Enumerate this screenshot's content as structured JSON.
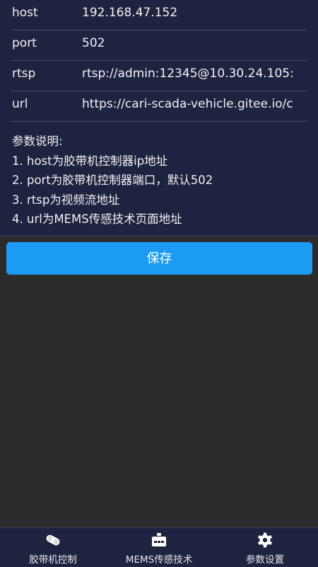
{
  "settings": {
    "fields": [
      {
        "label": "host",
        "value": "192.168.47.152"
      },
      {
        "label": "port",
        "value": "502"
      },
      {
        "label": "rtsp",
        "value": "rtsp://admin:12345@10.30.24.105:"
      },
      {
        "label": "url",
        "value": "https://cari-scada-vehicle.gitee.io/c"
      }
    ],
    "notes": [
      "参数说明:",
      "1. host为胶带机控制器ip地址",
      "2. port为胶带机控制器端口，默认502",
      "3. rtsp为视频流地址",
      "4. url为MEMS传感技术页面地址"
    ],
    "save_label": "保存"
  },
  "nav": {
    "items": [
      {
        "label": "胶带机控制",
        "icon": "belt-conveyor-icon"
      },
      {
        "label": "MEMS传感技术",
        "icon": "sensor-box-icon"
      },
      {
        "label": "参数设置",
        "icon": "gear-icon"
      }
    ]
  },
  "colors": {
    "panel_bg": "#1e2340",
    "page_bg": "#2b2b2b",
    "accent": "#1b9bf2"
  }
}
